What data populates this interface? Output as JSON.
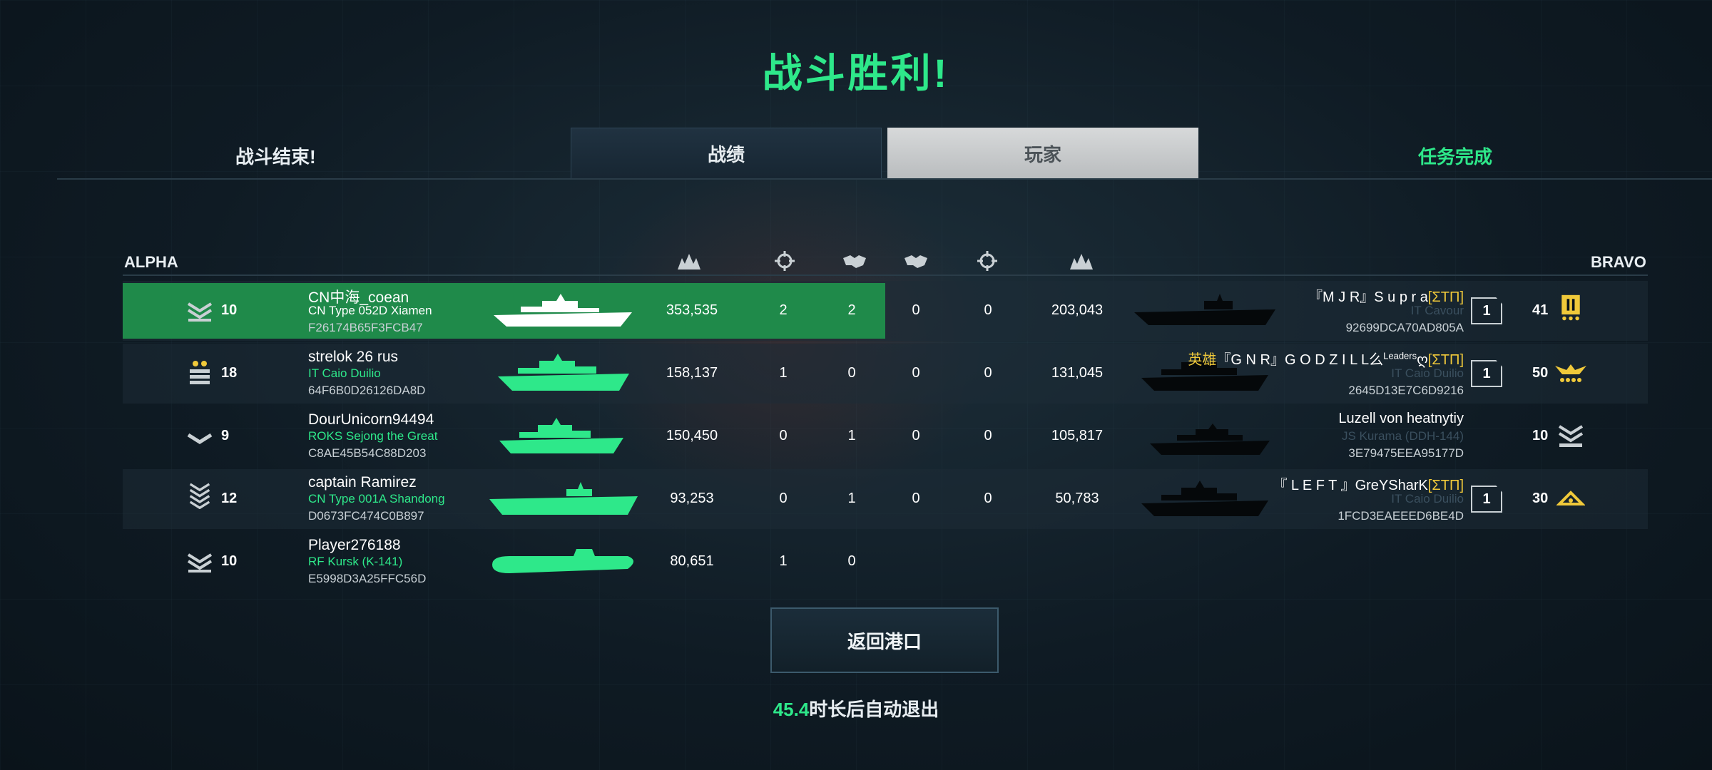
{
  "header": {
    "title": "战斗胜利!",
    "battle_over": "战斗结束!",
    "tabs": [
      {
        "label": "战绩",
        "active": false
      },
      {
        "label": "玩家",
        "active": true
      }
    ],
    "mission_done": "任务完成"
  },
  "teams": {
    "left": "ALPHA",
    "right": "BRAVO"
  },
  "column_icons": [
    "damage-icon",
    "crosshair-icon",
    "handshake-icon",
    "handshake-icon",
    "crosshair-icon",
    "damage-icon"
  ],
  "alpha_players": [
    {
      "rank": "10",
      "name": "CN中海_coean",
      "ship": "CN Type 052D Xiamen",
      "id": "F26174B65F3FCB47",
      "damage": "353,535",
      "kills": "2",
      "assists": "2",
      "highlight": true
    },
    {
      "rank": "18",
      "name": "strelok 26 rus",
      "ship": "IT Caio Duilio",
      "id": "64F6B0D26126DA8D",
      "damage": "158,137",
      "kills": "1",
      "assists": "0"
    },
    {
      "rank": "9",
      "name": "DourUnicorn94494",
      "ship": "ROKS Sejong the Great",
      "id": "C8AE45B54C88D203",
      "damage": "150,450",
      "kills": "0",
      "assists": "1"
    },
    {
      "rank": "12",
      "name": "captain Ramirez",
      "ship": "CN Type 001A Shandong",
      "id": "D0673FC474C0B897",
      "damage": "93,253",
      "kills": "0",
      "assists": "1"
    },
    {
      "rank": "10",
      "name": "Player276188",
      "ship": "RF Kursk (K-141)",
      "id": "E5998D3A25FFC56D",
      "damage": "80,651",
      "kills": "1",
      "assists": "0"
    }
  ],
  "bravo_players": [
    {
      "assists": "0",
      "kills": "0",
      "damage": "203,043",
      "prefix": "",
      "name": "『M J R』S u p r a",
      "tag": "[ΣTΠ]",
      "ship": "IT Cavour",
      "id": "92699DCA70AD805A",
      "squad": "1",
      "rank": "41"
    },
    {
      "assists": "0",
      "kills": "0",
      "damage": "131,045",
      "prefix": "英雄",
      "name": "『G N R』G O D Z I L L么",
      "sup": "Leaders",
      "suffix": "ღ",
      "tag": "[ΣTΠ]",
      "ship": "IT Caio Duilio",
      "id": "2645D13E7C6D9216",
      "squad": "1",
      "rank": "50"
    },
    {
      "assists": "0",
      "kills": "0",
      "damage": "105,817",
      "prefix": "",
      "name": "Luzell von heatnytiy",
      "tag": "",
      "ship": "JS Kurama (DDH-144)",
      "id": "3E79475EEA95177D",
      "squad": "",
      "rank": "10"
    },
    {
      "assists": "0",
      "kills": "0",
      "damage": "50,783",
      "prefix": "",
      "name": "『 L E F T 』GreYSharK",
      "tag": "[ΣTΠ]",
      "ship": "IT Caio Duilio",
      "id": "1FCD3EAEEED6BE4D",
      "squad": "1",
      "rank": "30"
    }
  ],
  "footer": {
    "return_label": "返回港口",
    "countdown": "45.4",
    "countdown_text": "时长后自动退出"
  },
  "colors": {
    "accent_green": "#2ee88a",
    "highlight_row": "#1f8a4a",
    "clan_tag": "#f0c93a"
  }
}
